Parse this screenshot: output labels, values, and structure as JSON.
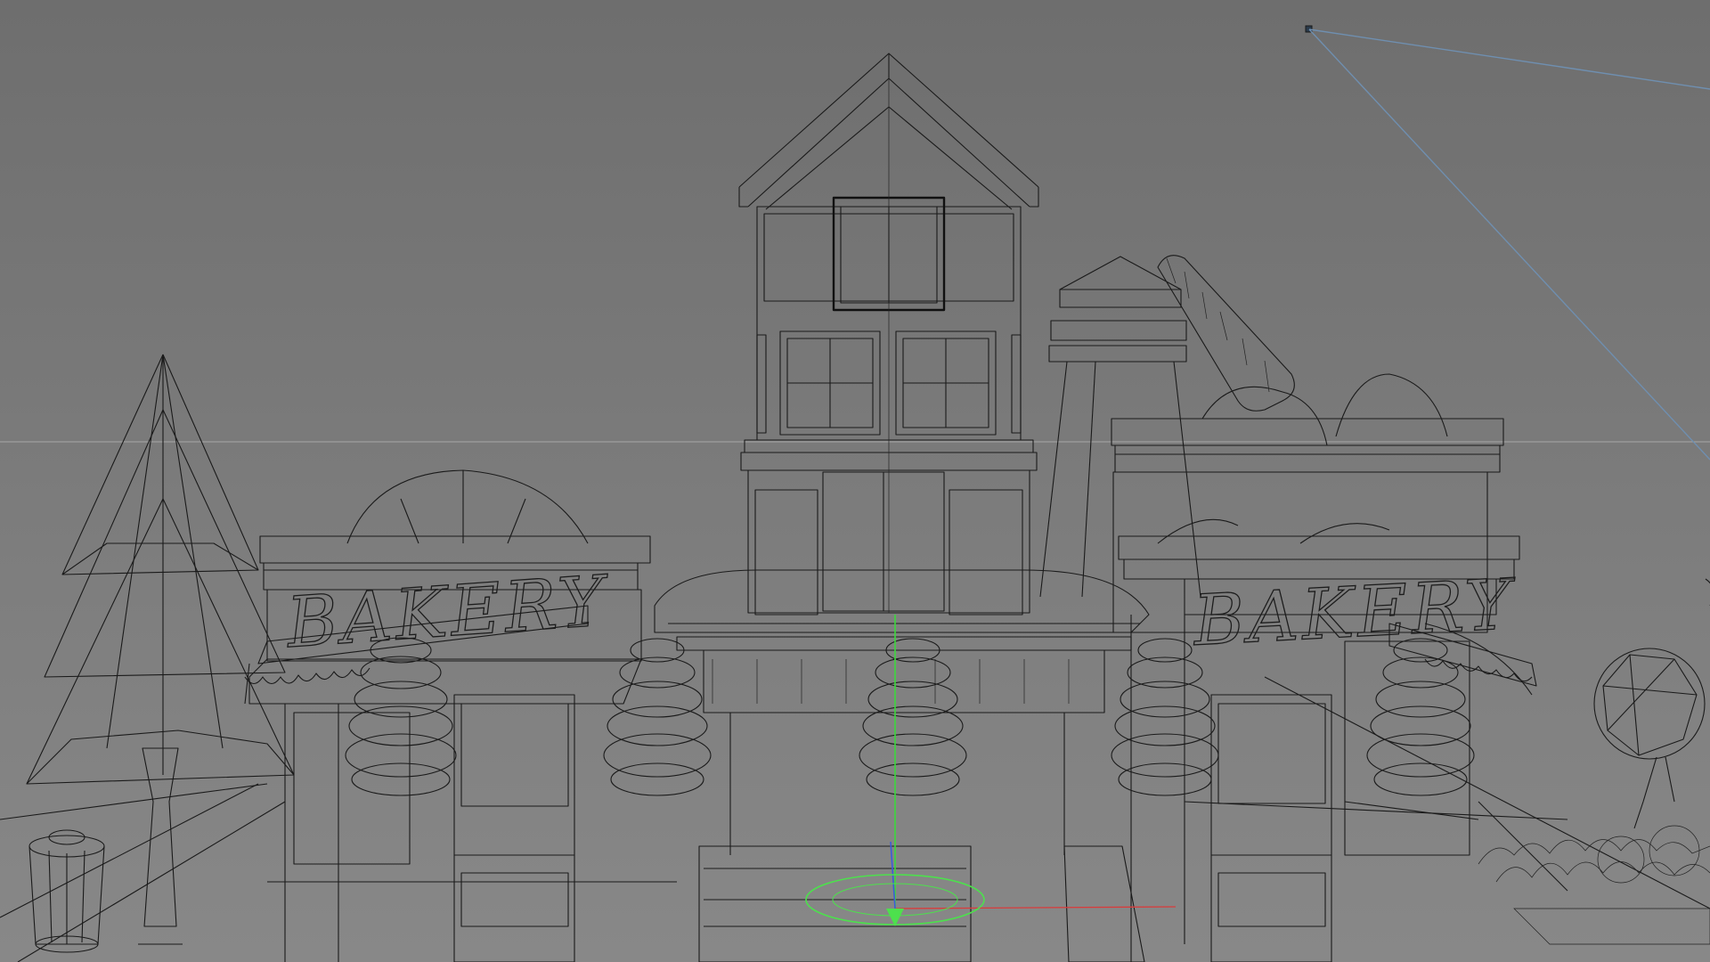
{
  "viewport": {
    "background_top": "#6e6e6e",
    "background_bottom": "#888888",
    "wire_color": "#1a1a1a",
    "camera_line_color": "#6f8fb0",
    "horizon_color": "#a8a8a8"
  },
  "signs": {
    "left": "BAKERY",
    "right": "BAKERY"
  },
  "gizmo": {
    "ring_color": "#4de04d",
    "x_axis_color": "#d83c3c",
    "y_axis_color": "#3cd83c",
    "z_axis_color": "#3c5cd8"
  }
}
